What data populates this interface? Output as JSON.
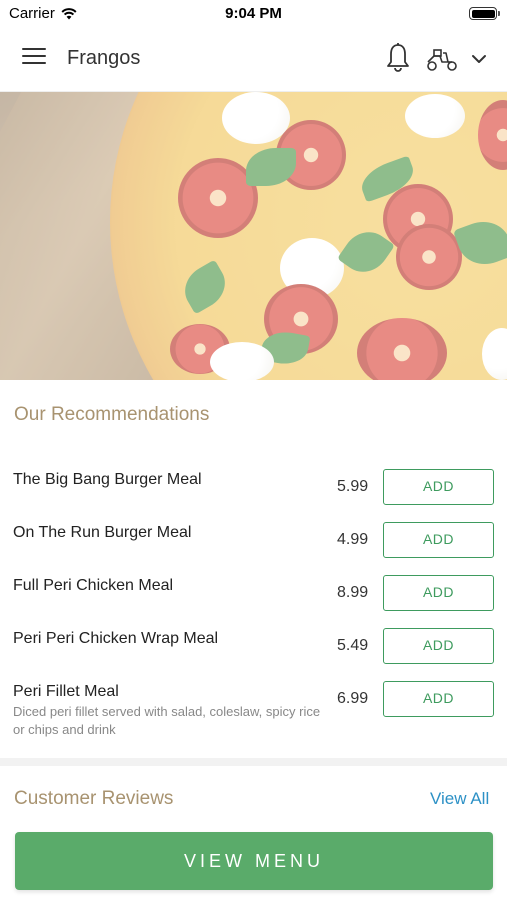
{
  "status_bar": {
    "carrier": "Carrier",
    "time": "9:04 PM"
  },
  "header": {
    "title": "Frangos",
    "icons": [
      "menu-icon",
      "bell-icon",
      "scooter-icon",
      "chevron-down-icon"
    ]
  },
  "hero": {
    "image": "pizza-image"
  },
  "recommendations": {
    "title": "Our Recommendations",
    "items": [
      {
        "name": "The Big Bang Burger Meal",
        "price": "5.99",
        "action": "ADD"
      },
      {
        "name": "On The Run Burger Meal",
        "price": "4.99",
        "action": "ADD"
      },
      {
        "name": "Full Peri Chicken Meal",
        "price": "8.99",
        "action": "ADD"
      },
      {
        "name": "Peri Peri Chicken Wrap Meal",
        "price": "5.49",
        "action": "ADD"
      },
      {
        "name": "Peri Fillet Meal",
        "description": "Diced peri fillet served with salad, coleslaw, spicy rice or chips and drink",
        "price": "6.99",
        "action": "ADD"
      }
    ]
  },
  "reviews": {
    "title": "Customer Reviews",
    "view_all": "View All"
  },
  "view_menu": {
    "label": "VIEW MENU"
  },
  "colors": {
    "accent_green": "#5aab6a",
    "link_blue": "#2d91c6",
    "section_title": "#a89370"
  }
}
